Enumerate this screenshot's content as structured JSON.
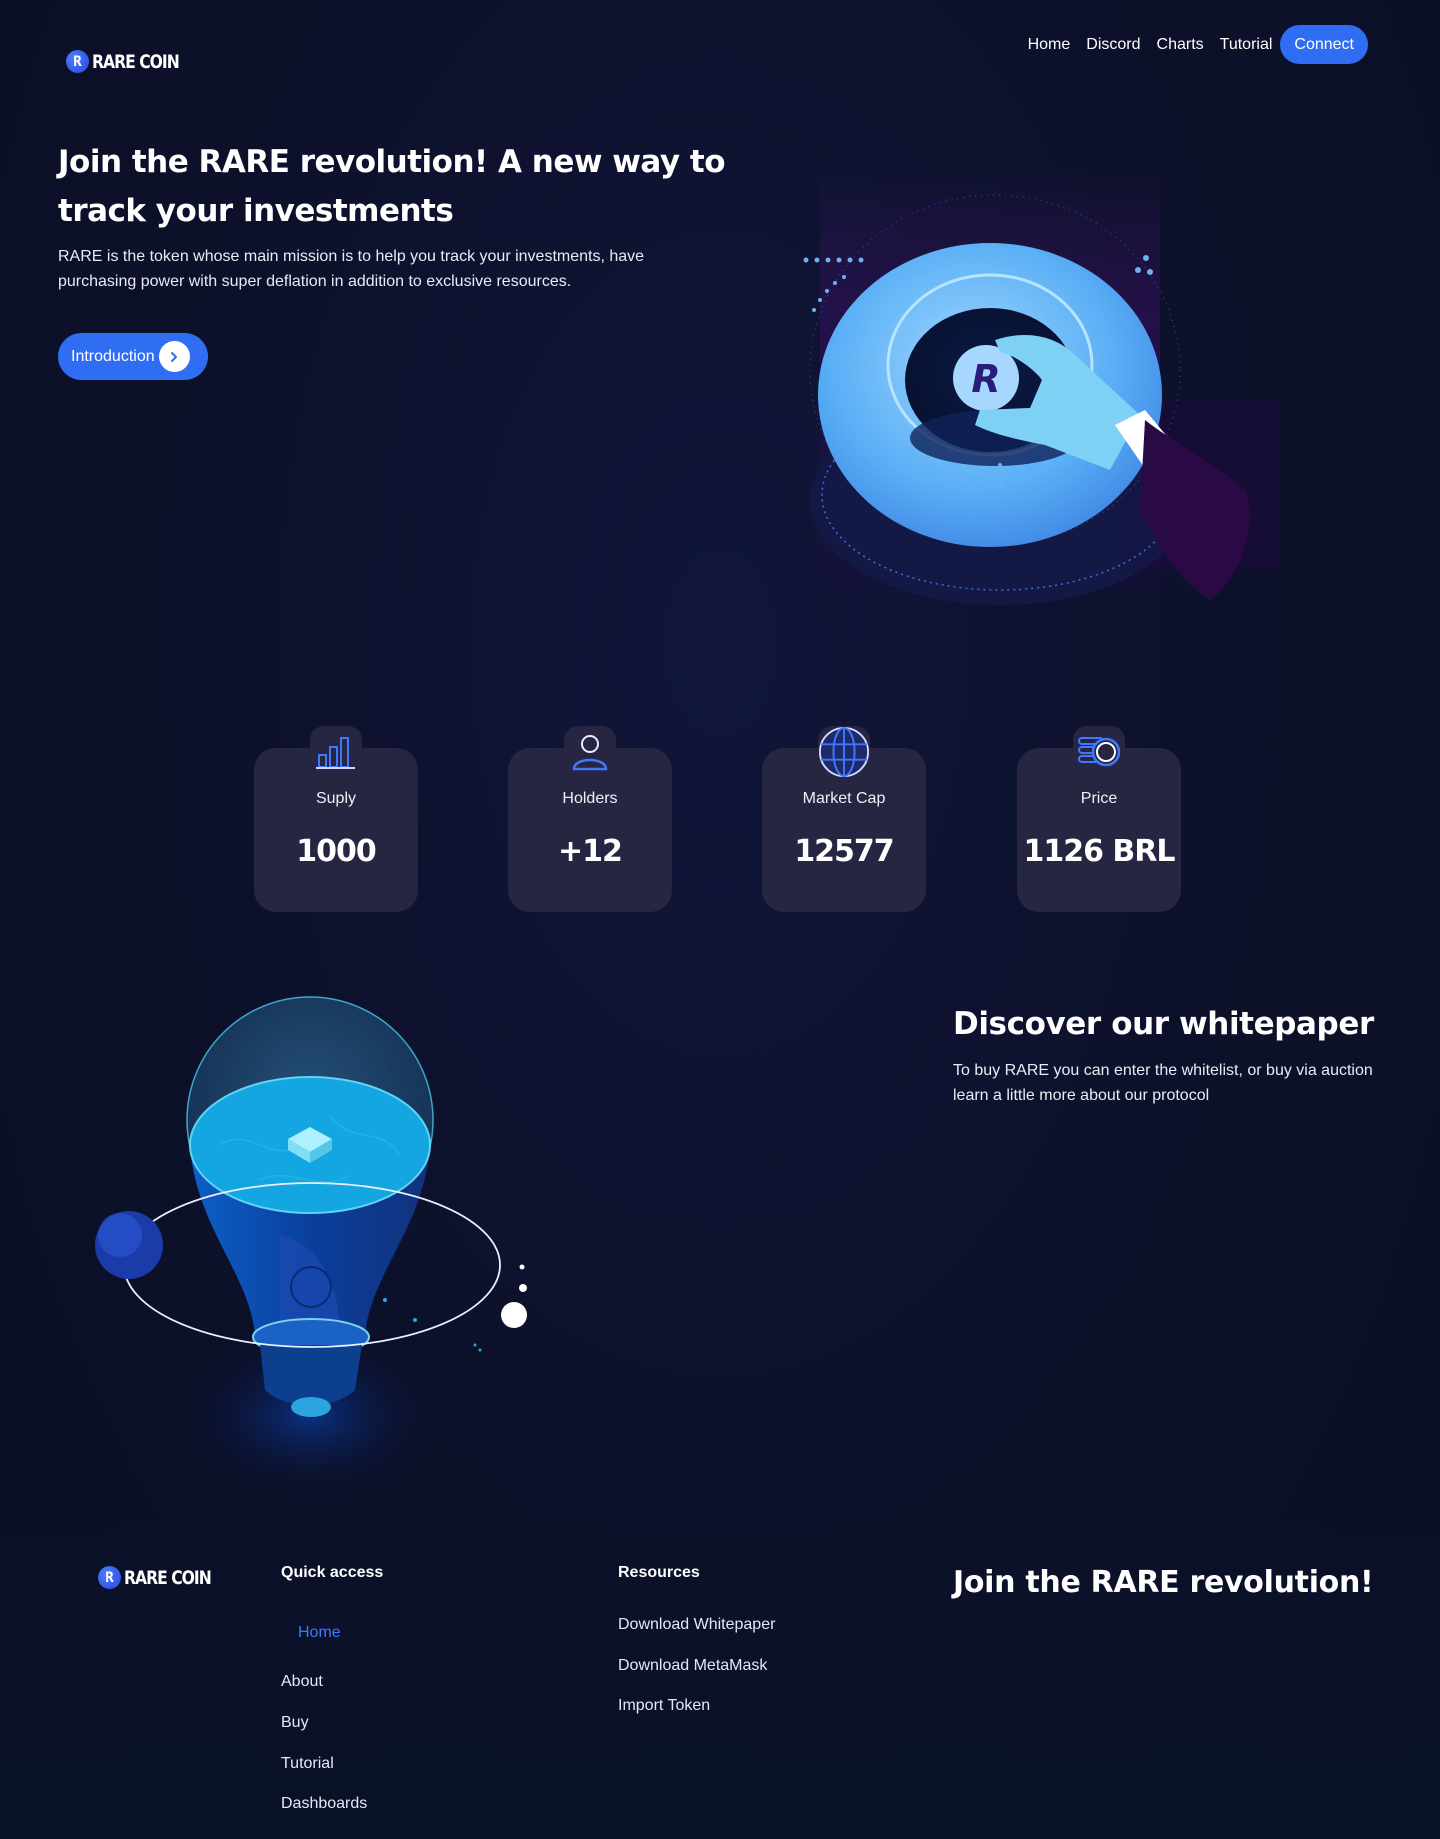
{
  "brand": {
    "coin_letter": "R",
    "name": "RARE COIN",
    "accent_color": "#2f6ef2",
    "background_color": "#0c1029",
    "card_color": "#262643"
  },
  "nav": {
    "items": [
      "Home",
      "Discord",
      "Charts",
      "Tutorial"
    ],
    "connect_label": "Connect"
  },
  "hero": {
    "title": "Join the RARE revolution! A new way to track your investments",
    "subtitle": "RARE is the token whose main mission is to help you track your investments, have purchasing power with super deflation in addition to exclusive resources.",
    "intro_button": "Introduction",
    "coin_letter": "R"
  },
  "stats": [
    {
      "icon": "bar-chart-icon",
      "label": "Suply",
      "value": "1000"
    },
    {
      "icon": "user-icon",
      "label": "Holders",
      "value": "+12"
    },
    {
      "icon": "globe-icon",
      "label": "Market Cap",
      "value": "12577"
    },
    {
      "icon": "coins-icon",
      "label": "Price",
      "value": "1126 BRL"
    }
  ],
  "whitepaper": {
    "title": "Discover our whitepaper",
    "subtitle": "To buy RARE you can enter the whitelist, or buy via auction learn a little more about our protocol"
  },
  "footer": {
    "quick_access": {
      "heading": "Quick access",
      "links": [
        "Home",
        "About",
        "Buy",
        "Tutorial",
        "Dashboards"
      ],
      "active": "Home"
    },
    "resources": {
      "heading": "Resources",
      "links": [
        "Download Whitepaper",
        "Download MetaMask",
        "Import Token"
      ]
    },
    "cta": "Join the RARE revolution!"
  }
}
